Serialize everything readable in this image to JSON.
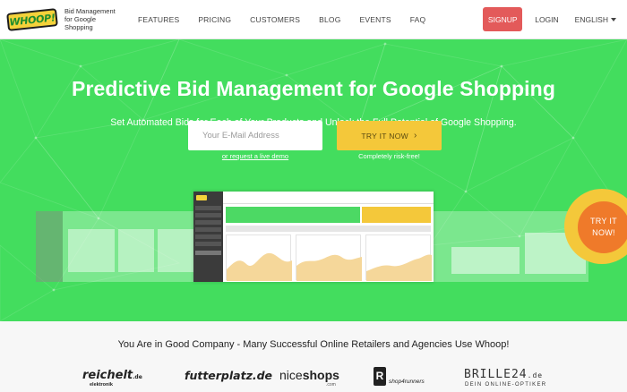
{
  "nav": {
    "logo_text": "WHOOP!",
    "tagline_line1": "Bid Management",
    "tagline_line2": "for Google Shopping",
    "menu": [
      "FEATURES",
      "PRICING",
      "CUSTOMERS",
      "BLOG",
      "EVENTS",
      "FAQ"
    ],
    "signup": "SIGNUP",
    "login": "LOGIN",
    "language": "ENGLISH"
  },
  "hero": {
    "title": "Predictive Bid Management for Google Shopping",
    "subtitle": "Set Automated Bids for Each of Your Products and Unlock the Full Potential of Google Shopping.",
    "email_placeholder": "Your E-Mail Address",
    "try_button": "TRY IT NOW",
    "demo_link": "or request a live demo",
    "risk_free": "Completely risk-free!",
    "badge_line1": "TRY IT",
    "badge_line2": "NOW!",
    "colors": {
      "hero_bg": "#43dd5e",
      "accent_yellow": "#f4c83a",
      "signup_red": "#e35a5a",
      "badge_orange": "#ef7a2a"
    }
  },
  "company": {
    "headline": "You Are in Good Company - Many Successful Online Retailers and Agencies Use Whoop!",
    "logos": {
      "reichelt": "reichelt",
      "reichelt_tld": ".de",
      "reichelt_sub": "elektronik",
      "futterplatz": "futterplatz.de",
      "niceshops_a": "nice",
      "niceshops_b": "shops",
      "niceshops_sub": ".com",
      "shop4runners_mark": "R",
      "shop4runners": "shop4runners",
      "brille": "BRILLE24",
      "brille_tld": ".de",
      "brille_sub": "DEIN ONLINE-OPTIKER"
    }
  }
}
